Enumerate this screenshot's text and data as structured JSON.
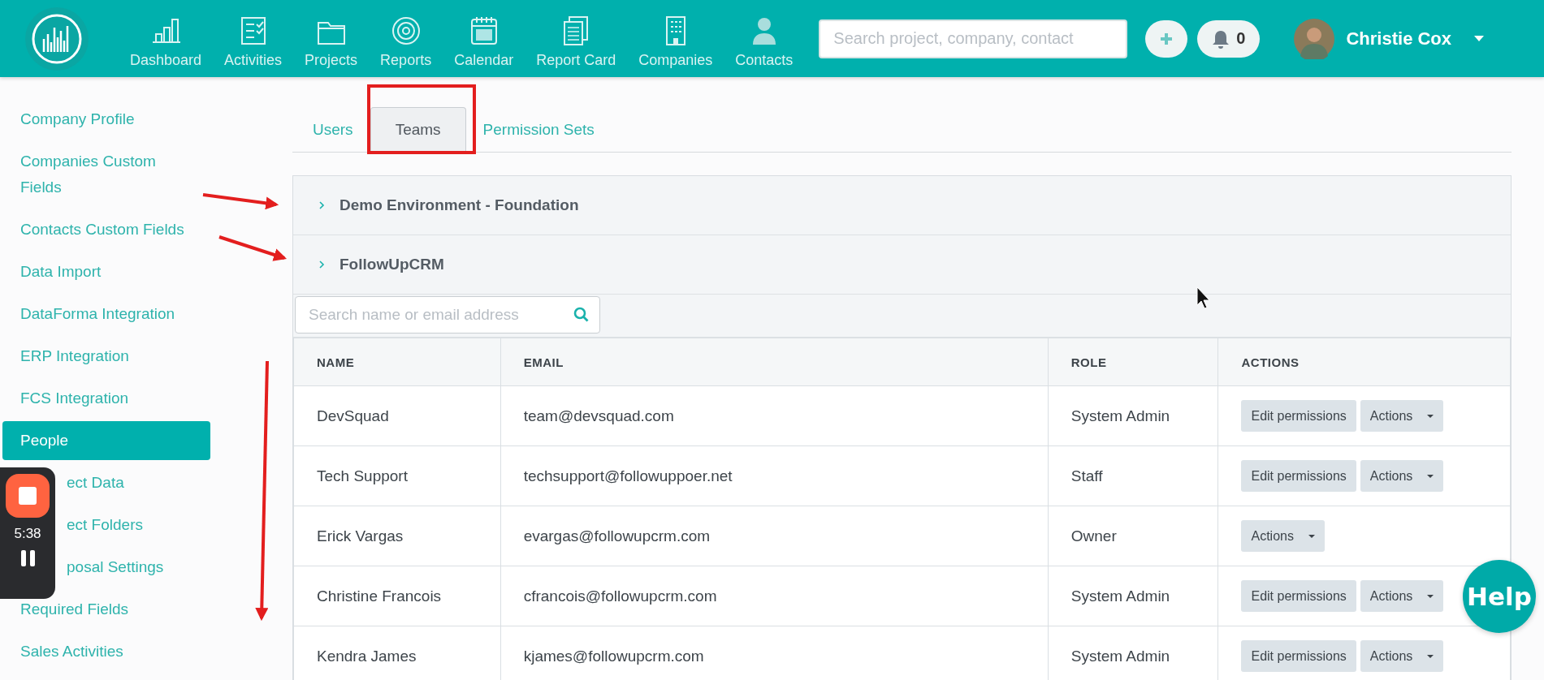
{
  "header": {
    "nav": [
      {
        "label": "Dashboard"
      },
      {
        "label": "Activities"
      },
      {
        "label": "Projects"
      },
      {
        "label": "Reports"
      },
      {
        "label": "Calendar"
      },
      {
        "label": "Report Card"
      },
      {
        "label": "Companies"
      },
      {
        "label": "Contacts"
      }
    ],
    "search": {
      "placeholder": "Search project, company, contact"
    },
    "notifications": "0",
    "user": "Christie Cox"
  },
  "sidebar": {
    "items": [
      {
        "label": "Company Profile",
        "selected": false
      },
      {
        "label": "Companies Custom Fields",
        "selected": false
      },
      {
        "label": "Contacts Custom Fields",
        "selected": false
      },
      {
        "label": "Data Import",
        "selected": false
      },
      {
        "label": "DataForma Integration",
        "selected": false
      },
      {
        "label": "ERP Integration",
        "selected": false
      },
      {
        "label": "FCS Integration",
        "selected": false
      },
      {
        "label": "People",
        "selected": true
      },
      {
        "label": "ect Data",
        "selected": false
      },
      {
        "label": "ect Folders",
        "selected": false
      },
      {
        "label": "posal Settings",
        "selected": false
      },
      {
        "label": "Required Fields",
        "selected": false
      },
      {
        "label": "Sales Activities",
        "selected": false
      }
    ]
  },
  "tabs": [
    {
      "label": "Users",
      "selected": false
    },
    {
      "label": "Teams",
      "selected": true
    },
    {
      "label": "Permission Sets",
      "selected": false
    }
  ],
  "teams": [
    {
      "label": "Demo Environment - Foundation"
    },
    {
      "label": "FollowUpCRM"
    }
  ],
  "member_search": {
    "placeholder": "Search name or email address"
  },
  "table": {
    "columns": [
      "NAME",
      "EMAIL",
      "ROLE",
      "ACTIONS"
    ],
    "rows": [
      {
        "name": "DevSquad",
        "email": "team@devsquad.com",
        "role": "System Admin",
        "buttons": [
          {
            "label": "Edit permissions",
            "kind": "plain"
          },
          {
            "label": "Actions",
            "kind": "dropdown"
          }
        ]
      },
      {
        "name": "Tech Support",
        "email": "techsupport@followuppoer.net",
        "role": "Staff",
        "buttons": [
          {
            "label": "Edit permissions",
            "kind": "plain"
          },
          {
            "label": "Actions",
            "kind": "dropdown"
          }
        ]
      },
      {
        "name": "Erick Vargas",
        "email": "evargas@followupcrm.com",
        "role": "Owner",
        "buttons": [
          {
            "label": "Actions",
            "kind": "dropdown"
          }
        ]
      },
      {
        "name": "Christine Francois",
        "email": "cfrancois@followupcrm.com",
        "role": "System Admin",
        "buttons": [
          {
            "label": "Edit permissions",
            "kind": "plain"
          },
          {
            "label": "Actions",
            "kind": "dropdown"
          }
        ]
      },
      {
        "name": "Kendra James",
        "email": "kjames@followupcrm.com",
        "role": "System Admin",
        "buttons": [
          {
            "label": "Edit permissions",
            "kind": "plain"
          },
          {
            "label": "Actions",
            "kind": "dropdown"
          }
        ]
      }
    ]
  },
  "recorder": {
    "time": "5:38"
  },
  "help": "Help"
}
